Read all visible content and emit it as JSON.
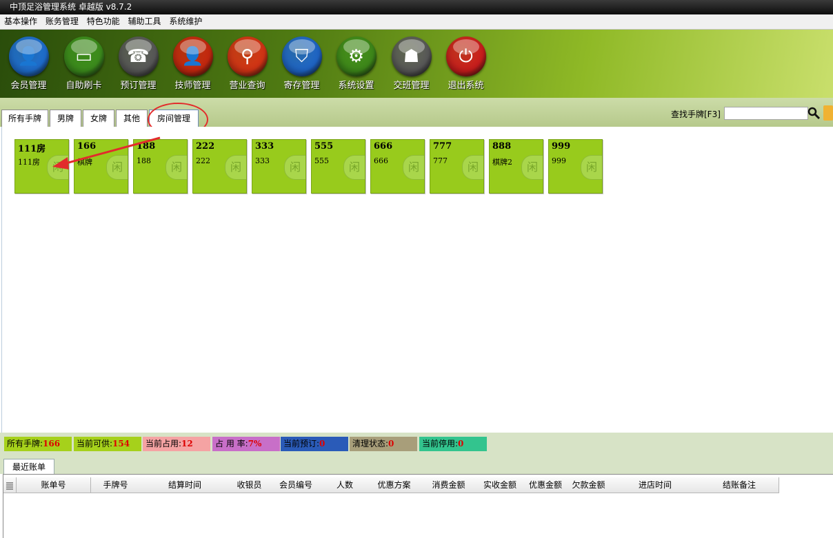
{
  "window": {
    "title": "中顶足浴管理系统 卓越版 v8.7.2"
  },
  "menu": [
    "基本操作",
    "账务管理",
    "特色功能",
    "辅助工具",
    "系统维护"
  ],
  "toolbar": [
    {
      "label": "会员管理",
      "icon": "member-icon",
      "color": "#1f6fd1",
      "glyph": "👤"
    },
    {
      "label": "自助刷卡",
      "icon": "card-icon",
      "color": "#3d8f1d",
      "glyph": "▭"
    },
    {
      "label": "预订管理",
      "icon": "phone-icon",
      "color": "#5a5a5a",
      "glyph": "☎"
    },
    {
      "label": "技师管理",
      "icon": "technician-icon",
      "color": "#c8280f",
      "glyph": "👤"
    },
    {
      "label": "营业查询",
      "icon": "magnifier-icon",
      "color": "#d63415",
      "glyph": "⚲"
    },
    {
      "label": "寄存管理",
      "icon": "bag-icon",
      "color": "#1f66c9",
      "glyph": "⛉"
    },
    {
      "label": "系统设置",
      "icon": "gear-icon",
      "color": "#3e8a1a",
      "glyph": "⚙"
    },
    {
      "label": "交班管理",
      "icon": "meeting-icon",
      "color": "#5a5a5a",
      "glyph": "☗"
    },
    {
      "label": "退出系统",
      "icon": "power-icon",
      "color": "#cc1d1d",
      "glyph": "⏻"
    }
  ],
  "tabs": [
    "所有手牌",
    "男牌",
    "女牌",
    "其他",
    "房间管理"
  ],
  "search": {
    "label": "查找手牌[F3]",
    "value": ""
  },
  "rooms": [
    {
      "number": "111房",
      "name": "111房"
    },
    {
      "number": "166",
      "name": "棋牌"
    },
    {
      "number": "188",
      "name": "188"
    },
    {
      "number": "222",
      "name": "222"
    },
    {
      "number": "333",
      "name": "333"
    },
    {
      "number": "555",
      "name": "555"
    },
    {
      "number": "666",
      "name": "666"
    },
    {
      "number": "777",
      "name": "777"
    },
    {
      "number": "888",
      "name": "棋牌2"
    },
    {
      "number": "999",
      "name": "999"
    }
  ],
  "room_badge": "闲",
  "status": [
    {
      "label": "所有手牌:",
      "value": "166",
      "color": "#a6d11b"
    },
    {
      "label": "当前可供:",
      "value": "154",
      "color": "#a6d11b"
    },
    {
      "label": "当前占用:",
      "value": "12",
      "color": "#f5a3a3"
    },
    {
      "label": "占 用 率:",
      "value": "7%",
      "color": "#c86fc8"
    },
    {
      "label": "当前预订:",
      "value": "0",
      "color": "#2a5bb8"
    },
    {
      "label": "清理状态:",
      "value": "0",
      "color": "#a89e7a"
    },
    {
      "label": "当前停用:",
      "value": "0",
      "color": "#33c48e"
    }
  ],
  "bottom_tab": "最近账单",
  "columns": [
    "账单号",
    "手牌号",
    "结算时间",
    "收银员",
    "会员编号",
    "人数",
    "优惠方案",
    "消费金额",
    "实收金额",
    "优惠金额",
    "欠款金额",
    "进店时间",
    "结账备注"
  ]
}
